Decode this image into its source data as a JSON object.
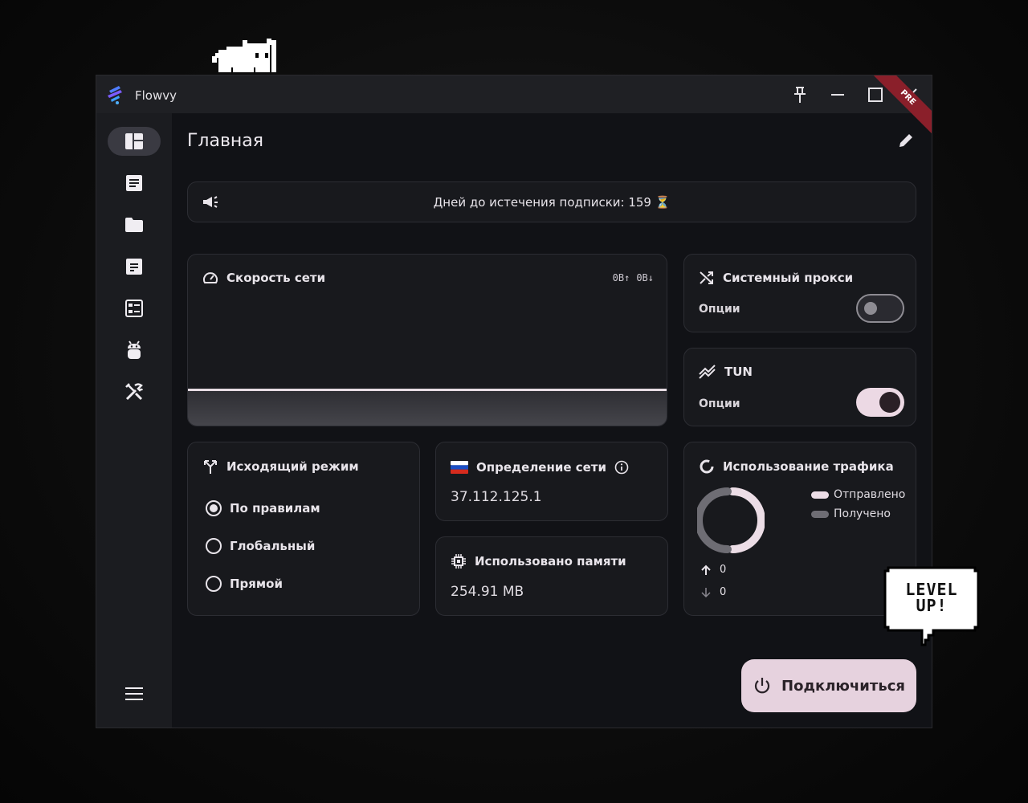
{
  "window": {
    "app_name": "Flowvy",
    "badge": "PRE"
  },
  "page": {
    "title": "Главная"
  },
  "banner": {
    "text": "Дней до истечения подписки: 159 ⏳"
  },
  "network_speed": {
    "title": "Скорость сети",
    "upload": "0B↑",
    "download": "0B↓"
  },
  "system_proxy": {
    "title": "Системный прокси",
    "options_label": "Опции",
    "enabled": false
  },
  "tun": {
    "title": "TUN",
    "options_label": "Опции",
    "enabled": true
  },
  "outbound_mode": {
    "title": "Исходящий режим",
    "options": [
      "По правилам",
      "Глобальный",
      "Прямой"
    ],
    "selected": "По правилам"
  },
  "network_detection": {
    "title": "Определение сети",
    "ip": "37.112.125.1"
  },
  "memory": {
    "title": "Использовано памяти",
    "value": "254.91  MB"
  },
  "traffic": {
    "title": "Использование трафика",
    "legend_sent": "Отправлено",
    "legend_received": "Получено",
    "up": "0",
    "down": "0",
    "colors": {
      "sent": "#ecdde6",
      "received": "#6e6d74"
    }
  },
  "connect_button": {
    "label": "Подключиться"
  },
  "sticker": {
    "line1": "LEVEL",
    "line2": "UP!"
  },
  "colors": {
    "accent": "#e6d2de",
    "background": "#111216",
    "card": "#18191d",
    "sidebar": "#1b1c20"
  }
}
